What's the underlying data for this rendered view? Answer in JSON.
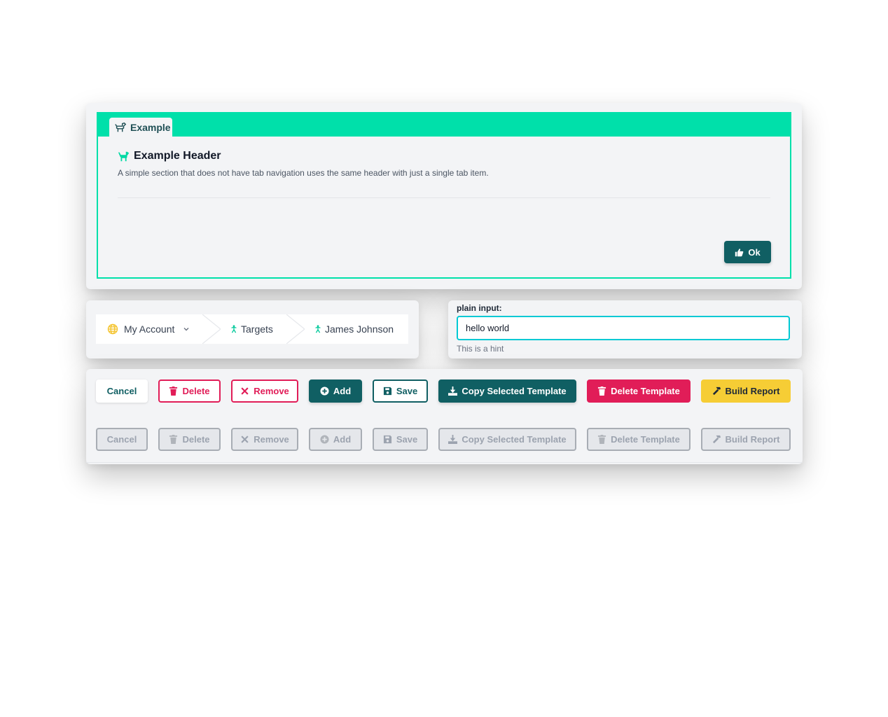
{
  "example": {
    "tab_label": "Example",
    "header_title": "Example Header",
    "description": "A simple section that does not have tab navigation uses the same header with just a single tab item.",
    "ok_label": "Ok"
  },
  "breadcrumb": {
    "items": [
      {
        "label": "My Account",
        "icon": "globe-icon",
        "dropdown": true
      },
      {
        "label": "Targets",
        "icon": "person-icon"
      },
      {
        "label": "James Johnson",
        "icon": "person-icon"
      }
    ]
  },
  "input": {
    "label": "plain input:",
    "value": "hello world",
    "hint": "This is a hint"
  },
  "buttons": {
    "cancel": "Cancel",
    "delete": "Delete",
    "remove": "Remove",
    "add": "Add",
    "save": "Save",
    "copy_template": "Copy Selected Template",
    "delete_template": "Delete Template",
    "build_report": "Build Report"
  },
  "colors": {
    "accent": "#00e0aa",
    "primary": "#105f63",
    "danger": "#e11d58",
    "warning": "#f6cd35",
    "focus": "#00c9d4"
  }
}
